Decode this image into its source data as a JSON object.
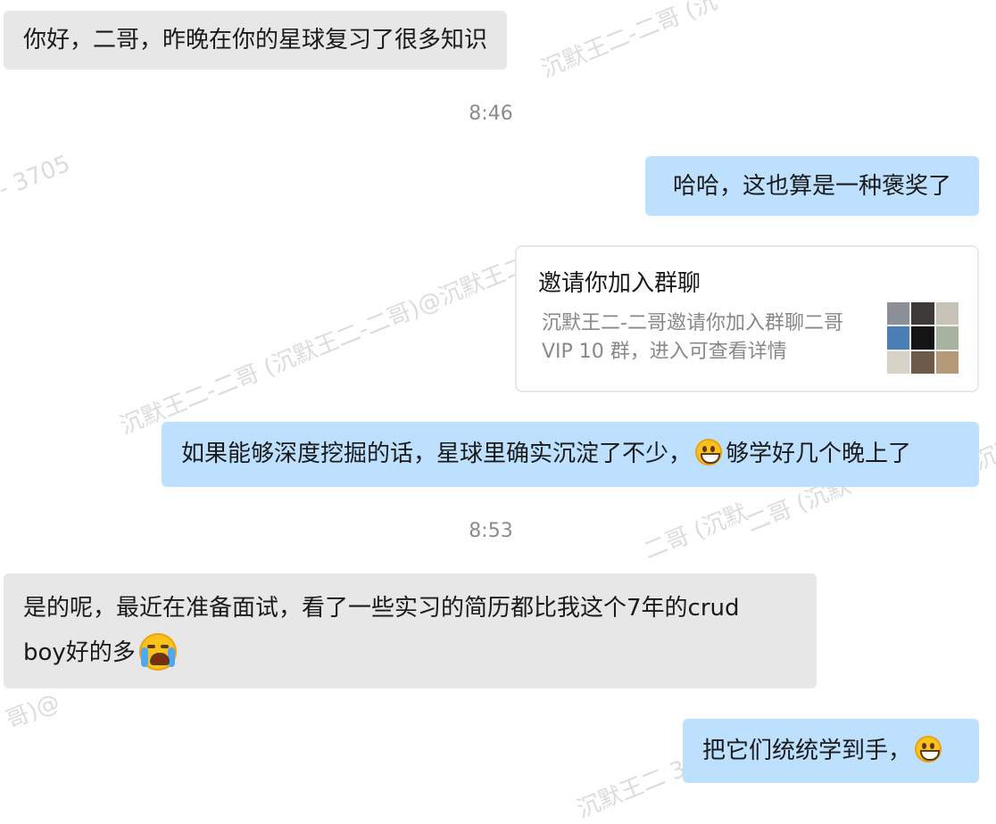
{
  "watermark": {
    "text": "沉默王二-二哥 (沉默王二-二哥)@沉默王二 3705",
    "frag_a": "沉默王二-二哥 (沉默王二-二哥)@沉默王二",
    "frag_b": "- 3705",
    "frag_c": "沉默王二-二哥 (沉",
    "frag_d": "二哥 (沉默",
    "frag_e": "沉默王二 37",
    "frag_f": "哥)@",
    "frag_g": "沉默"
  },
  "messages": [
    {
      "side": "left",
      "text": "你好，二哥，昨晚在你的星球复习了很多知识"
    },
    {
      "side": "time",
      "text": "8:46"
    },
    {
      "side": "right",
      "text": "哈哈，这也算是一种褒奖了"
    },
    {
      "side": "card",
      "title": "邀请你加入群聊",
      "desc_line1": "沉默王二-二哥邀请你加入群聊二哥",
      "desc_line2": "VIP 10 群，进入可查看详情"
    },
    {
      "side": "right",
      "text_before": "如果能够深度挖掘的话，星球里确实沉淀了不少，",
      "emoji": "grinning-face",
      "text_after": "够学好几个晚上了"
    },
    {
      "side": "time",
      "text": "8:53"
    },
    {
      "side": "left",
      "line1": "是的呢，最近在准备面试，看了一些实习的简历都比我这个7年的crud",
      "line2": "boy好的多",
      "emoji": "loudly-crying-face"
    },
    {
      "side": "right",
      "text": "把它们统统学到手，",
      "emoji": "grinning-face"
    }
  ],
  "colors": {
    "left_bubble": "#e7e7e7",
    "right_bubble": "#bde0fe",
    "time": "#8c8c8c",
    "watermark": "#dcdcdc"
  },
  "avatar_colors": [
    "#8a8f98",
    "#3e3a3a",
    "#c9c2b8",
    "#4a7fb5",
    "#141414",
    "#a8b2a0",
    "#d8d2c8",
    "#6e5a48",
    "#b49a78"
  ]
}
